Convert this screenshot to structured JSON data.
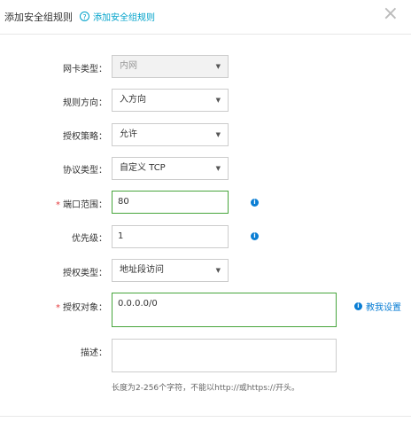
{
  "dialog": {
    "title": "添加安全组规则",
    "help_label": "添加安全组规则",
    "close": "×"
  },
  "fields": {
    "nic_type": {
      "label": "网卡类型：",
      "value": "内网"
    },
    "direction": {
      "label": "规则方向：",
      "value": "入方向"
    },
    "policy": {
      "label": "授权策略：",
      "value": "允许"
    },
    "protocol": {
      "label": "协议类型：",
      "value": "自定义 TCP"
    },
    "port_range": {
      "required": "*",
      "label": "端口范围：",
      "value": "80"
    },
    "priority": {
      "label": "优先级：",
      "value": "1"
    },
    "auth_type": {
      "label": "授权类型：",
      "value": "地址段访问"
    },
    "auth_object": {
      "required": "*",
      "label": "授权对象：",
      "value": "0.0.0.0/0",
      "link": "教我设置"
    },
    "description": {
      "label": "描述：",
      "value": "",
      "hint": "长度为2-256个字符，不能以http://或https://开头。"
    }
  },
  "icons": {
    "caret": "▼",
    "info": "i",
    "question": "?"
  },
  "colors": {
    "accent": "#0a7ed4",
    "valid": "#47a53c",
    "required": "#e4393c"
  }
}
